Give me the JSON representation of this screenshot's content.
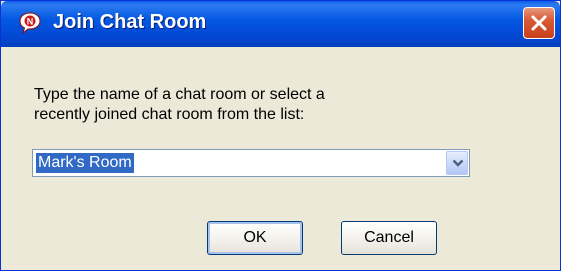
{
  "window": {
    "title": "Join Chat Room",
    "app_icon": "chat-bubble-icon",
    "close_icon": "close-icon",
    "colors": {
      "titlebar": "#0458e3",
      "close_button": "#d85a35",
      "dialog_background": "#ece9d8",
      "selection": "#316ac5"
    }
  },
  "dialog": {
    "prompt_line1": "Type the name of a chat room or select a",
    "prompt_line2": "recently joined chat room from the list:",
    "room_combo": {
      "value": "Mark's Room",
      "arrow_icon": "chevron-down-icon"
    },
    "ok_label": "OK",
    "cancel_label": "Cancel"
  }
}
